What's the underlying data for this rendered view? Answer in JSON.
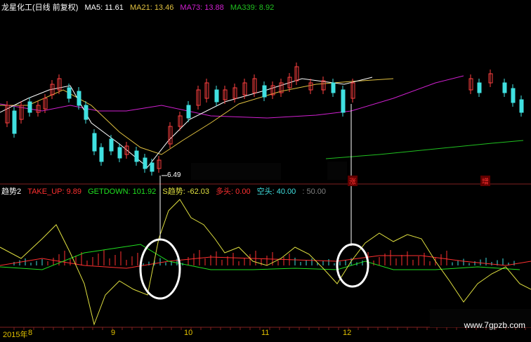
{
  "main_legend": {
    "title": "龙星化工(日线 前复权)",
    "ma5": "MA5: 11.61",
    "ma21": "MA21: 13.46",
    "ma73": "MA73: 13.88",
    "ma339": "MA339: 8.92"
  },
  "indicator_legend": {
    "name": "趋势2",
    "take_up": "TAKE_UP: 9.89",
    "getdown": "GETDOWN: 101.92",
    "trend": "S趋势: -62.03",
    "duotou": "多头: 0.00",
    "kongtou": "空头: 40.00",
    "fifty": ": 50.00"
  },
  "low_price_label": "6.49",
  "signal_labels": [
    "涨",
    "增"
  ],
  "x_axis_labels": [
    "2015年",
    "8",
    "9",
    "10",
    "11",
    "12"
  ],
  "watermark": "www.7gpzb.com",
  "colors": {
    "ma5": "#ffffff",
    "ma21": "#e0c040",
    "ma73": "#d020d0",
    "ma339": "#20c020",
    "up": "#ff4040",
    "down": "#40e0e0",
    "trend": "#e0e040",
    "red_band": "#ff3030",
    "green_band": "#20e020"
  },
  "chart_data": {
    "type": "line",
    "title": "龙星化工(日线 前复权)",
    "xlabel": "",
    "ylabel": "",
    "x_tick_labels": [
      "2015年",
      "8",
      "9",
      "10",
      "11",
      "12"
    ],
    "series": [
      {
        "name": "MA5",
        "last": 11.61
      },
      {
        "name": "MA21",
        "last": 13.46
      },
      {
        "name": "MA73",
        "last": 13.88
      },
      {
        "name": "MA339",
        "last": 8.92
      }
    ],
    "annotations": [
      {
        "text": "6.49",
        "note": "period low"
      }
    ],
    "indicator": {
      "name": "趋势2",
      "series": [
        {
          "name": "TAKE_UP",
          "last": 9.89
        },
        {
          "name": "GETDOWN",
          "last": 101.92
        },
        {
          "name": "S趋势",
          "last": -62.03
        },
        {
          "name": "多头",
          "last": 0.0
        },
        {
          "name": "空头",
          "last": 40.0
        }
      ]
    }
  }
}
